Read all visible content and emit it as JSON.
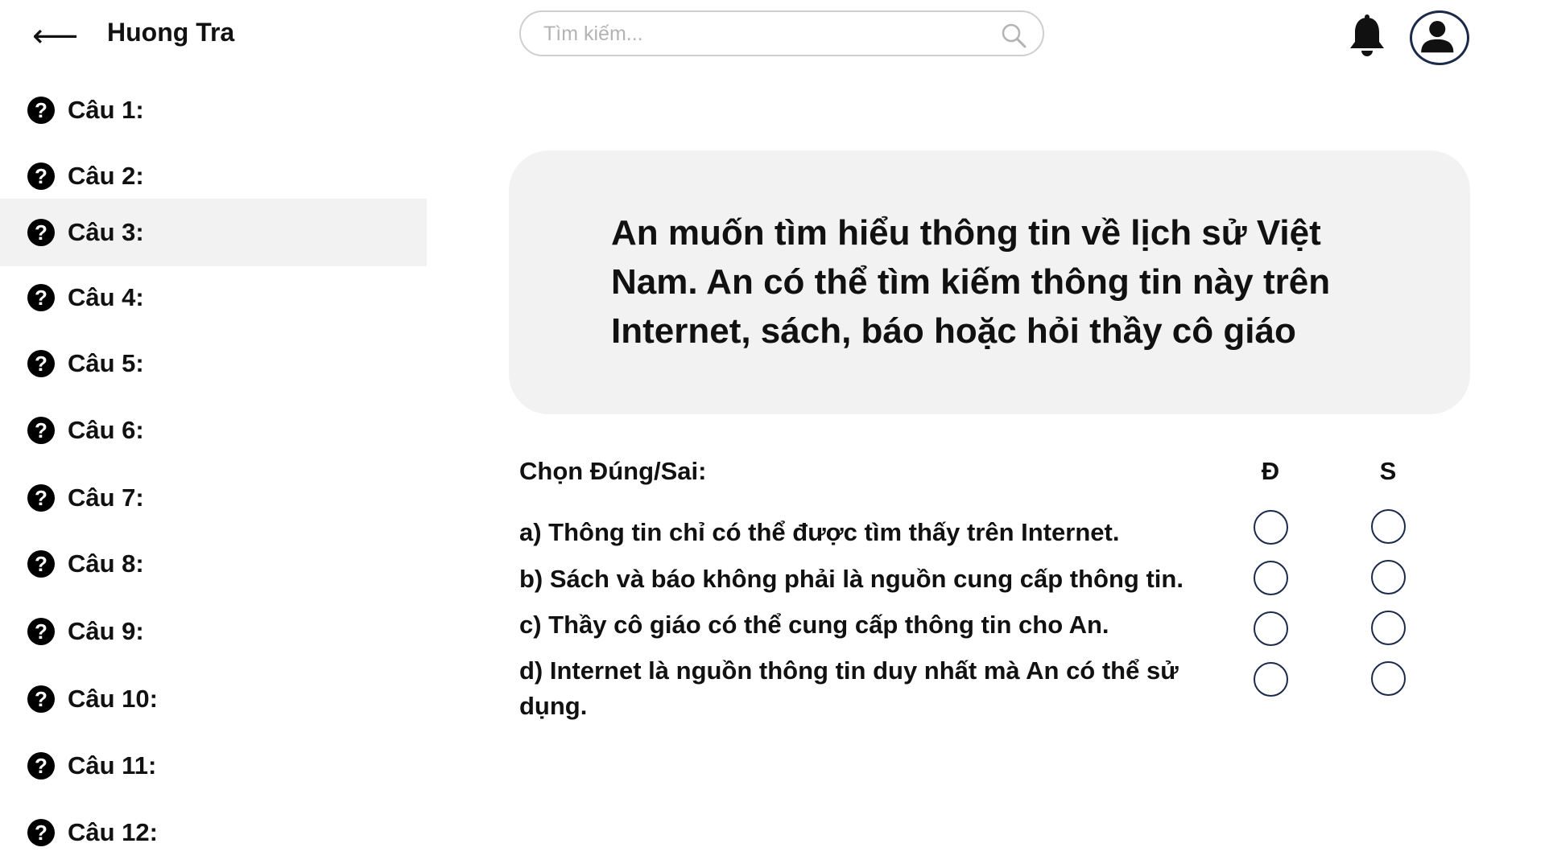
{
  "header": {
    "back_icon": "arrow-left-icon",
    "user_name": "Huong Tra",
    "search_placeholder": "Tìm kiếm...",
    "search_icon": "search-icon",
    "bell_icon": "bell-icon",
    "avatar_icon": "user-avatar-icon"
  },
  "sidebar": {
    "active_index": 2,
    "items": [
      {
        "label": "Câu 1:"
      },
      {
        "label": "Câu 2:"
      },
      {
        "label": "Câu 3:"
      },
      {
        "label": "Câu 4:"
      },
      {
        "label": "Câu 5:"
      },
      {
        "label": "Câu 6:"
      },
      {
        "label": "Câu 7:"
      },
      {
        "label": "Câu 8:"
      },
      {
        "label": "Câu 9:"
      },
      {
        "label": "Câu 10:"
      },
      {
        "label": "Câu 11:"
      },
      {
        "label": "Câu 12:"
      }
    ],
    "item_icon": "question-circle-icon",
    "active_bg": "#f2f2f2"
  },
  "question": {
    "prompt": "An muốn tìm hiểu thông tin về lịch sử Việt Nam. An có thể tìm kiếm thông tin này trên Internet, sách, báo hoặc hỏi thầy cô giáo"
  },
  "true_false": {
    "title": "Chọn Đúng/Sai:",
    "true_label": "Đ",
    "false_label": "S",
    "statements": [
      {
        "text": "a) Thông tin chỉ có thể được tìm thấy trên Internet."
      },
      {
        "text": "b) Sách và báo không phải là nguồn cung cấp thông tin."
      },
      {
        "text": "c) Thầy cô giáo có thể cung cấp thông tin cho An."
      },
      {
        "text": "d) Internet là nguồn thông tin duy nhất mà An có thể sử dụng."
      }
    ]
  },
  "colors": {
    "card_bg": "#f2f2f2",
    "radio_border": "#1b2a4a",
    "search_border": "#cfcfcf"
  }
}
